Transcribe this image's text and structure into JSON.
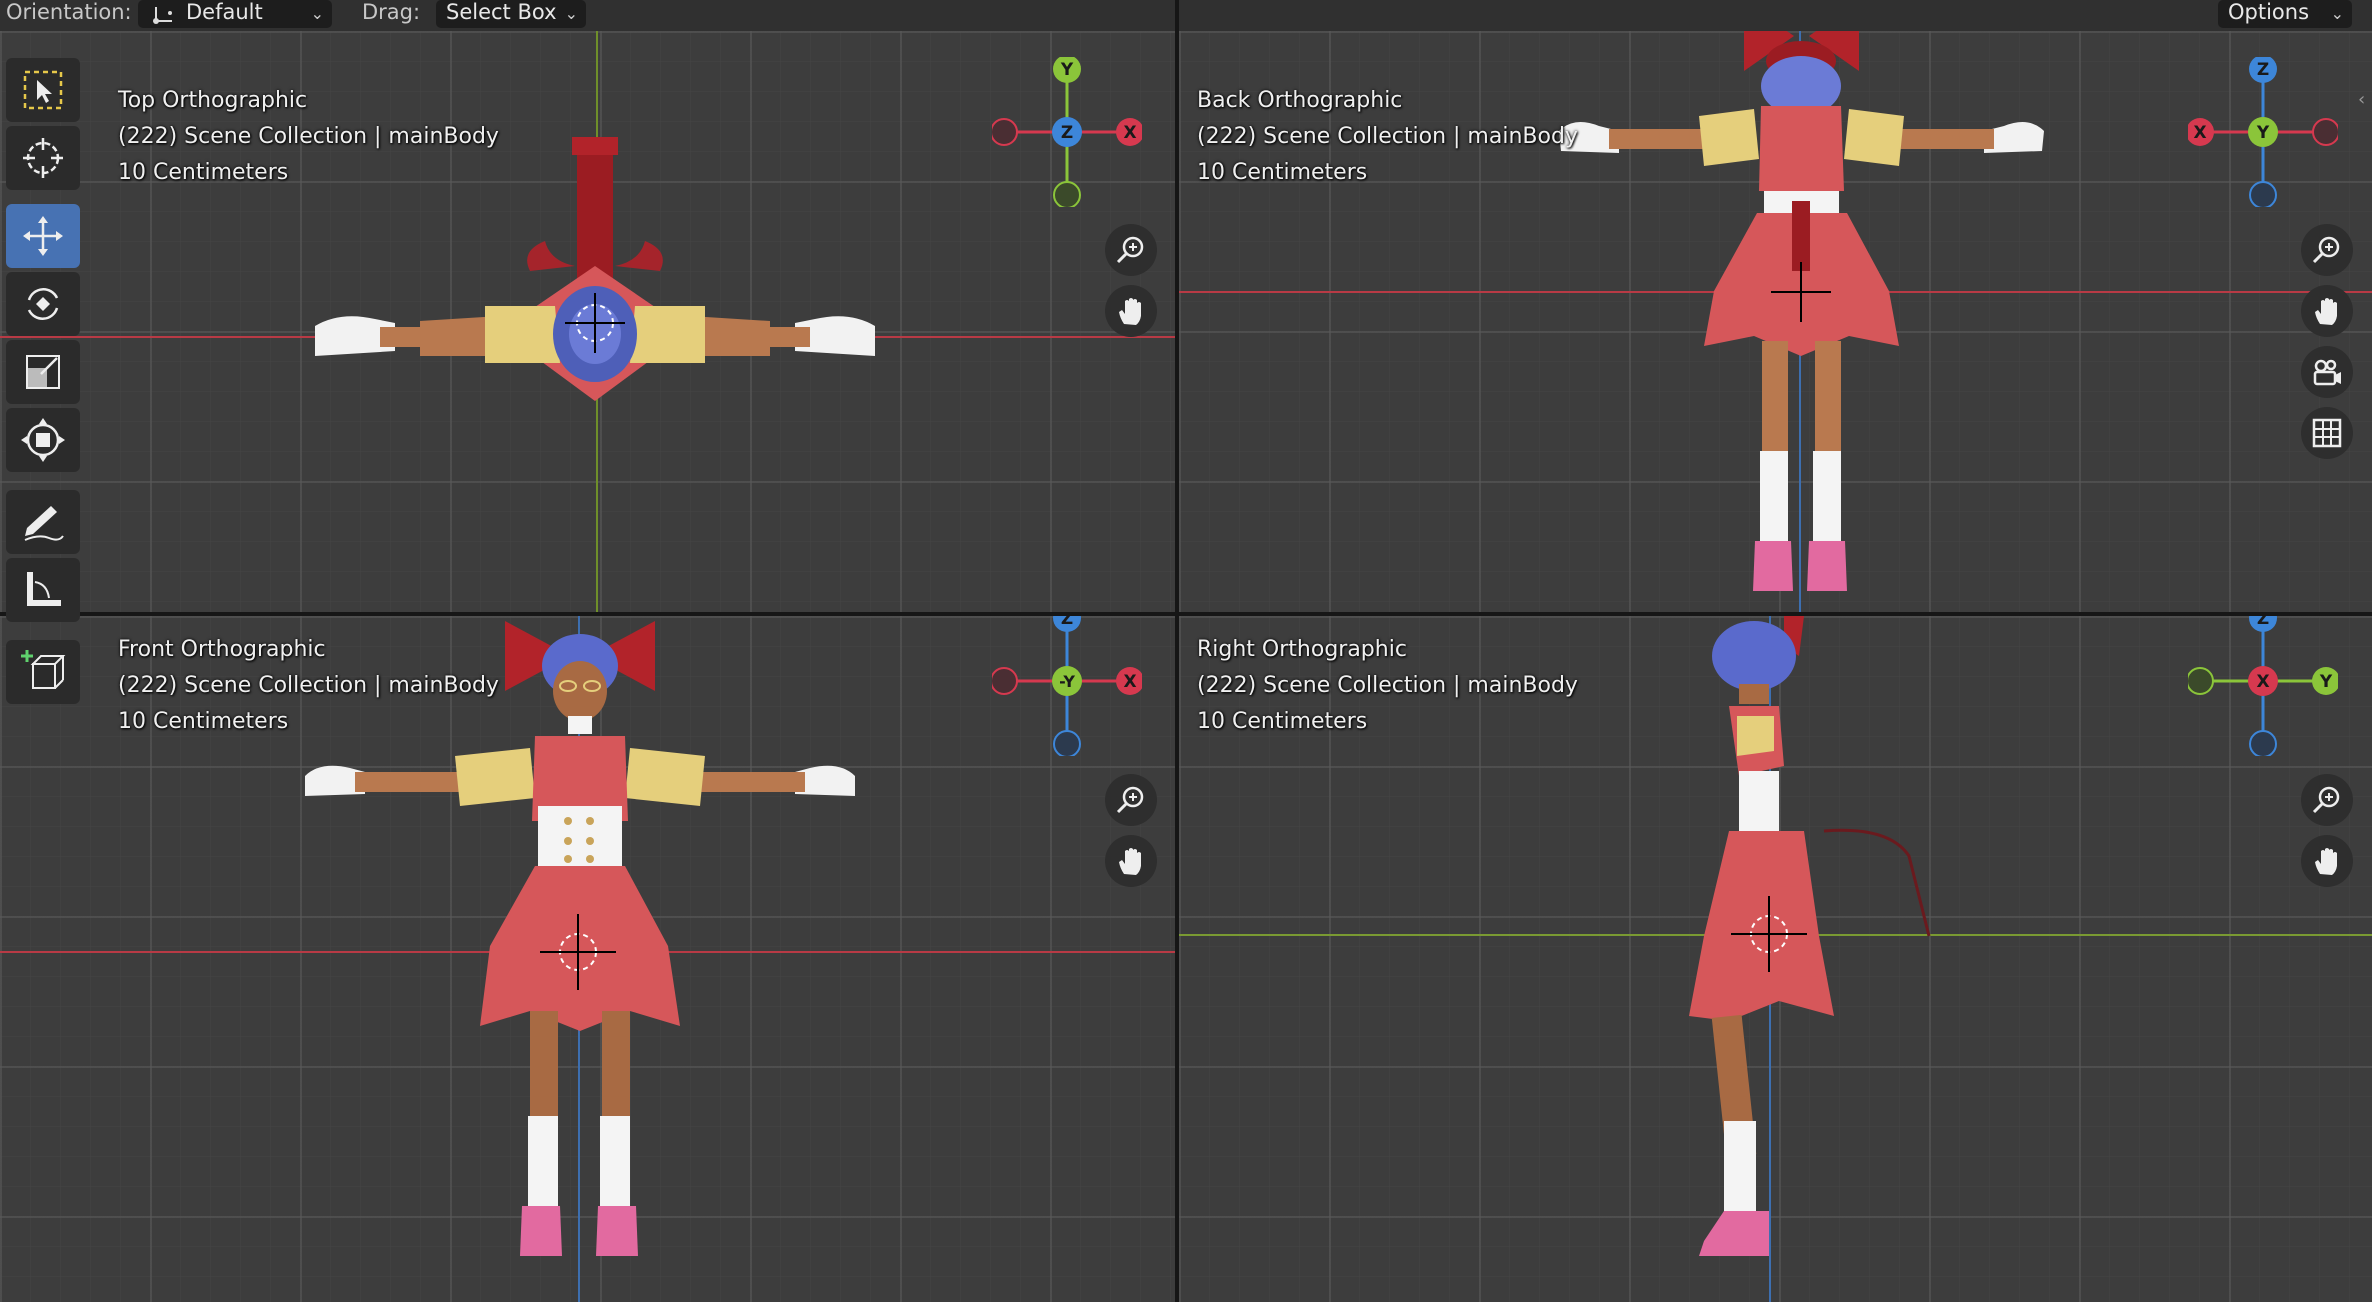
{
  "header": {
    "orientation_label": "Orientation:",
    "orientation_value": "Default",
    "drag_label": "Drag:",
    "drag_value": "Select Box",
    "options_label": "Options"
  },
  "toolbar": {
    "tools": [
      "select-box",
      "cursor",
      "move",
      "rotate",
      "scale",
      "transform",
      "annotate",
      "measure",
      "add-cube"
    ],
    "active_tool": "move"
  },
  "viewports": {
    "top": {
      "title": "Top Orthographic",
      "collection": "(222) Scene Collection | mainBody",
      "scale": "10 Centimeters"
    },
    "back": {
      "title": "Back Orthographic",
      "collection": "(222) Scene Collection | mainBody",
      "scale": "10 Centimeters"
    },
    "front": {
      "title": "Front Orthographic",
      "collection": "(222) Scene Collection | mainBody",
      "scale": "10 Centimeters"
    },
    "right": {
      "title": "Right Orthographic",
      "collection": "(222) Scene Collection | mainBody",
      "scale": "10 Centimeters"
    }
  },
  "gizmo_labels": {
    "top": {
      "up": "Y",
      "center": "Z",
      "right": "X"
    },
    "back": {
      "up": "Z",
      "center": "Y",
      "left": "X"
    },
    "front": {
      "up": "Z",
      "center": "-Y",
      "right": "X"
    },
    "right": {
      "up": "Z",
      "center": "X",
      "right": "Y"
    }
  },
  "colors": {
    "x_axis": "#d6394f",
    "y_axis": "#8bc53a",
    "z_axis": "#3d86d9",
    "active_tool": "#4772b3",
    "viewport_bg": "#3d3d3d"
  }
}
